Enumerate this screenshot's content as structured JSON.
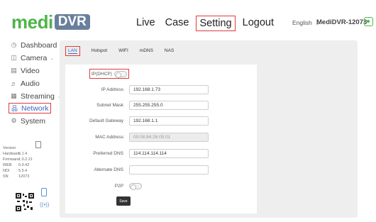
{
  "header": {
    "logo_medi": "medi",
    "logo_dvr": "DVR",
    "nav": [
      "Live",
      "Case",
      "Setting",
      "Logout"
    ],
    "active_nav": "Setting",
    "language": "English",
    "device_name": "MediDVR-12073"
  },
  "sidebar": {
    "items": [
      {
        "label": "Dashboard",
        "icon": "dashboard-icon"
      },
      {
        "label": "Camera",
        "icon": "camera-icon"
      },
      {
        "label": "Video",
        "icon": "video-icon"
      },
      {
        "label": "Audio",
        "icon": "audio-icon"
      },
      {
        "label": "Streaming",
        "icon": "streaming-icon"
      },
      {
        "label": "Network",
        "icon": "network-icon"
      },
      {
        "label": "System",
        "icon": "system-icon"
      }
    ],
    "active": "Network",
    "info": [
      {
        "key": "Version",
        "value": ""
      },
      {
        "key": "Hardware",
        "value": "5.1.4"
      },
      {
        "key": "Firmware",
        "value": "1.0.2.21"
      },
      {
        "key": "WEB",
        "value": "0.9.42"
      },
      {
        "key": "NDI",
        "value": "5.5.4"
      },
      {
        "key": "SN",
        "value": "12073"
      }
    ]
  },
  "tabs": [
    "LAN",
    "Hotspot",
    "WIFI",
    "mDNS",
    "NAS"
  ],
  "active_tab": "LAN",
  "form": {
    "dhcp_label": "IP(DHCP)",
    "dhcp_enabled": false,
    "ip_label": "IP Address",
    "ip_value": "192.168.1.73",
    "mask_label": "Subnet Mask",
    "mask_value": "255.255.255.0",
    "gateway_label": "Default Gateway",
    "gateway_value": "192.168.1.1",
    "mac_label": "MAC Address",
    "mac_value": "00:08:84:26:05:01",
    "dns1_label": "Preferred DNS",
    "dns1_value": "114.114.114.114",
    "dns2_label": "Alternate DNS",
    "dns2_value": "",
    "p2p_label": "P2P",
    "p2p_enabled": false,
    "save_label": "Save"
  },
  "colors": {
    "brand_green": "#4fb44a",
    "accent_blue": "#3a66c4",
    "highlight_red": "#e03b3b"
  }
}
